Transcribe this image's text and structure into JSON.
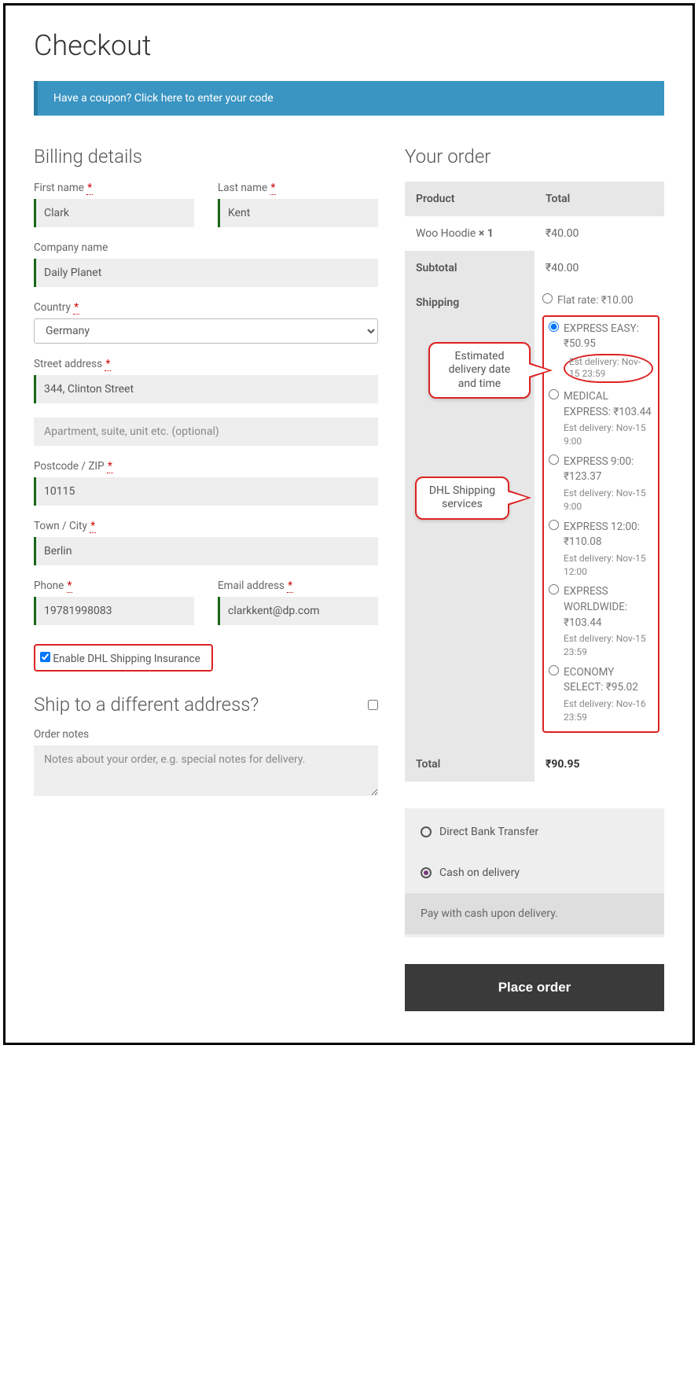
{
  "page_title": "Checkout",
  "coupon_notice": "Have a coupon? Click here to enter your code",
  "billing": {
    "heading": "Billing details",
    "first_name_label": "First name",
    "first_name_value": "Clark",
    "last_name_label": "Last name",
    "last_name_value": "Kent",
    "company_label": "Company name",
    "company_value": "Daily Planet",
    "country_label": "Country",
    "country_value": "Germany",
    "street_label": "Street address",
    "street1_value": "344, Clinton Street",
    "street2_placeholder": "Apartment, suite, unit etc. (optional)",
    "postcode_label": "Postcode / ZIP",
    "postcode_value": "10115",
    "city_label": "Town / City",
    "city_value": "Berlin",
    "phone_label": "Phone",
    "phone_value": "19781998083",
    "email_label": "Email address",
    "email_value": "clarkkent@dp.com",
    "insurance_label": "Enable DHL Shipping Insurance"
  },
  "ship_diff": {
    "heading": "Ship to a different address?",
    "notes_label": "Order notes",
    "notes_placeholder": "Notes about your order, e.g. special notes for delivery."
  },
  "order": {
    "heading": "Your order",
    "col_product": "Product",
    "col_total": "Total",
    "item_name": "Woo Hoodie ",
    "item_qty": "× 1",
    "item_total": "₹40.00",
    "subtotal_label": "Subtotal",
    "subtotal_value": "₹40.00",
    "shipping_label": "Shipping",
    "total_label": "Total",
    "total_value": "₹90.95"
  },
  "shipping_options": [
    {
      "label": "Flat rate: ₹10.00",
      "est": "",
      "selected": false
    },
    {
      "label": "EXPRESS EASY: ₹50.95",
      "est": "Est delivery: Nov-15 23:59",
      "selected": true
    },
    {
      "label": "MEDICAL EXPRESS: ₹103.44",
      "est": "Est delivery: Nov-15 9:00",
      "selected": false
    },
    {
      "label": "EXPRESS 9:00: ₹123.37",
      "est": "Est delivery: Nov-15 9:00",
      "selected": false
    },
    {
      "label": "EXPRESS 12:00: ₹110.08",
      "est": "Est delivery: Nov-15 12:00",
      "selected": false
    },
    {
      "label": "EXPRESS WORLDWIDE: ₹103.44",
      "est": "Est delivery: Nov-15 23:59",
      "selected": false
    },
    {
      "label": "ECONOMY SELECT: ₹95.02",
      "est": "Est delivery: Nov-16 23:59",
      "selected": false
    }
  ],
  "payment": {
    "bank": "Direct Bank Transfer",
    "cod": "Cash on delivery",
    "cod_desc": "Pay with cash upon delivery.",
    "place_order": "Place order"
  },
  "callouts": {
    "est": "Estimated delivery date and time",
    "dhl": "DHL Shipping services"
  },
  "required_mark": "*"
}
